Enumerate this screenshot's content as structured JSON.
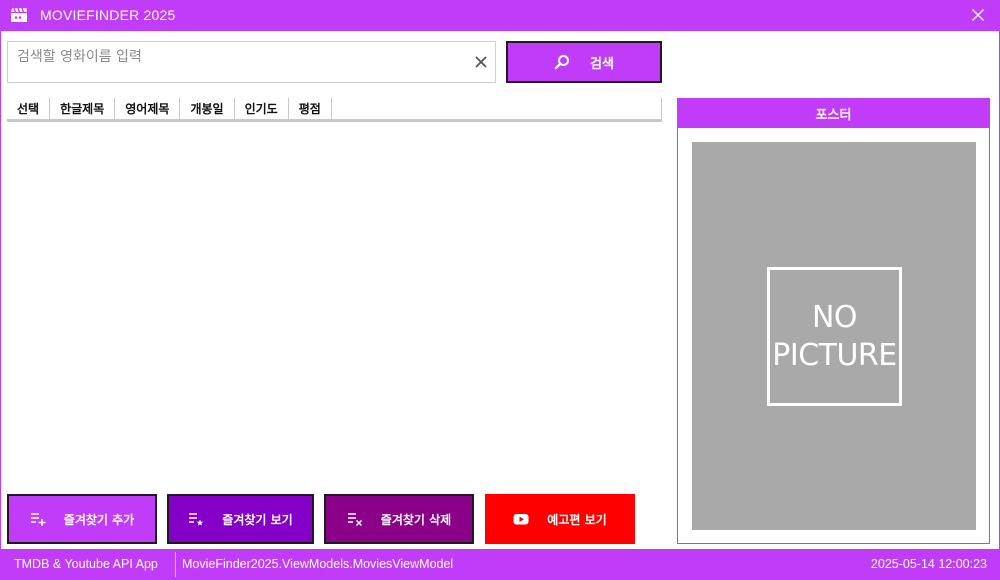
{
  "window": {
    "title": "MOVIEFINDER 2025"
  },
  "search": {
    "placeholder": "검색할 영화이름 입력",
    "value": "",
    "button_label": "검색"
  },
  "table": {
    "columns": [
      "선택",
      "한글제목",
      "영어제목",
      "개봉일",
      "인기도",
      "평점"
    ],
    "rows": []
  },
  "poster": {
    "header": "포스터",
    "placeholder_line1": "NO",
    "placeholder_line2": "PICTURE"
  },
  "buttons": {
    "add_favorite": "즐겨찾기 추가",
    "view_favorites": "즐겨찾기 보기",
    "delete_favorite": "즐겨찾기 삭제",
    "watch_trailer": "예고편 보기"
  },
  "statusbar": {
    "left": "TMDB & Youtube API App",
    "middle": "MovieFinder2025.ViewModels.MoviesViewModel",
    "datetime": "2025-05-14 12:00:23"
  },
  "colors": {
    "accent": "#c03cf8",
    "view_button": "#8400c8",
    "delete_button": "#8b0089",
    "trailer_button": "#ff0000",
    "poster_placeholder": "#a9a9a9"
  },
  "icons": {
    "app": "clapperboard-icon",
    "close": "close-icon",
    "clear": "clear-icon",
    "search": "search-icon",
    "add_favorite": "playlist-add-icon",
    "view_favorites": "playlist-star-icon",
    "delete_favorite": "playlist-remove-icon",
    "trailer": "youtube-icon"
  }
}
